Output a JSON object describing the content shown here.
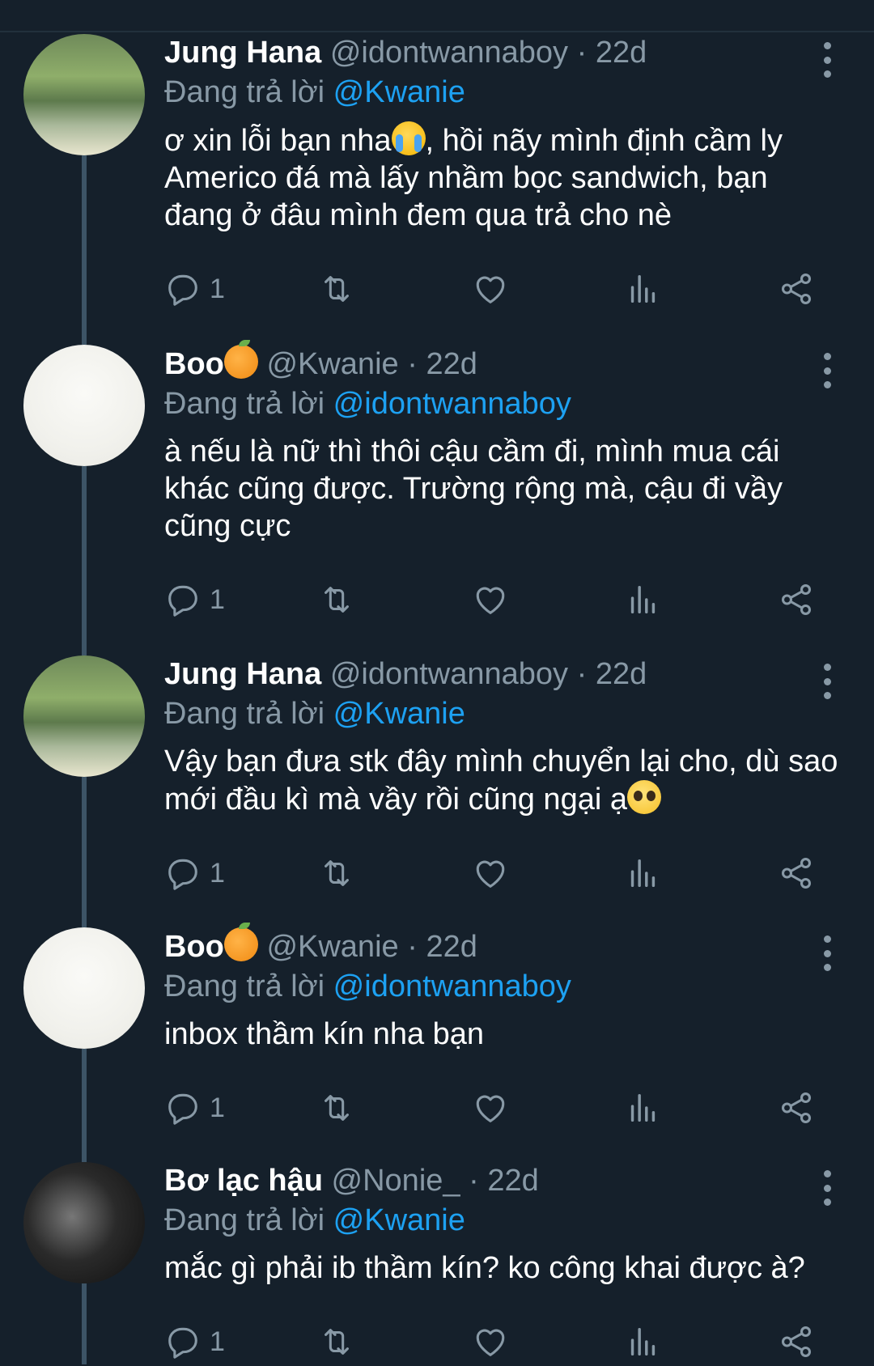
{
  "tweets": [
    {
      "name": "Jung Hana",
      "name_emoji": "",
      "handle": "@idontwannaboy",
      "dot": "·",
      "time": "22d",
      "reply_label": "Đang trả lời",
      "reply_to": "@Kwanie",
      "text_parts": [
        "ơ xin lỗi bạn nha",
        ", hồi nãy mình định cầm ly Americo đá mà lấy nhầm bọc sandwich, bạn đang ở đâu mình đem qua trả cho nè"
      ],
      "text_emoji": "loudly-crying-face-emoji",
      "reply_count": "1",
      "avatar": "hana"
    },
    {
      "name": "Boo",
      "name_emoji": "tangerine-emoji",
      "handle": "@Kwanie",
      "dot": "·",
      "time": "22d",
      "reply_label": "Đang trả lời",
      "reply_to": "@idontwannaboy",
      "text_parts": [
        "à nếu là nữ thì thôi cậu cầm đi, mình mua cái khác cũng được. Trường rộng mà, cậu đi vầy cũng cực",
        ""
      ],
      "text_emoji": "",
      "reply_count": "1",
      "avatar": "boo"
    },
    {
      "name": "Jung Hana",
      "name_emoji": "",
      "handle": "@idontwannaboy",
      "dot": "·",
      "time": "22d",
      "reply_label": "Đang trả lời",
      "reply_to": "@Kwanie",
      "text_parts": [
        "Vậy bạn đưa stk đây mình chuyển lại cho, dù sao mới đầu kì mà vầy rồi cũng ngại ạ",
        ""
      ],
      "text_emoji": "pleading-face-emoji",
      "reply_count": "1",
      "avatar": "hana"
    },
    {
      "name": "Boo",
      "name_emoji": "tangerine-emoji",
      "handle": "@Kwanie",
      "dot": "·",
      "time": "22d",
      "reply_label": "Đang trả lời",
      "reply_to": "@idontwannaboy",
      "text_parts": [
        "inbox thầm kín nha bạn",
        ""
      ],
      "text_emoji": "",
      "reply_count": "1",
      "avatar": "boo"
    },
    {
      "name": "Bơ lạc hậu",
      "name_emoji": "",
      "handle": "@Nonie_",
      "dot": "·",
      "time": "22d",
      "reply_label": "Đang trả lời",
      "reply_to": "@Kwanie",
      "text_parts": [
        "mắc gì phải ib thầm kín? ko công khai được à?",
        ""
      ],
      "text_emoji": "",
      "reply_count": "1",
      "avatar": "bo"
    }
  ],
  "icons": {
    "reply": "reply-icon",
    "retweet": "retweet-icon",
    "like": "heart-icon",
    "analytics": "analytics-icon",
    "share": "share-icon",
    "more": "more-vertical-icon"
  },
  "colors": {
    "background": "#15202b",
    "secondary_text": "#8899a6",
    "mention": "#1da1f2",
    "thread_line": "#3d5466"
  }
}
